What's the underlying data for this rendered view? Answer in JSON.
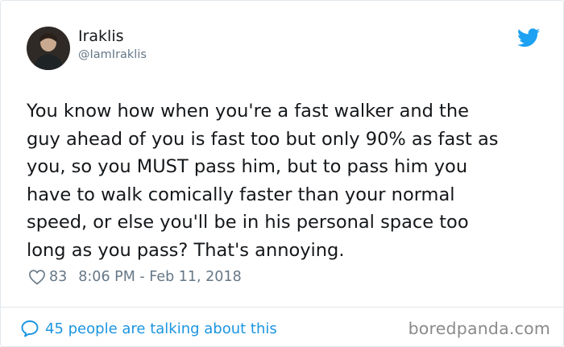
{
  "author": {
    "name": "Iraklis",
    "handle": "@IamIraklis"
  },
  "tweet": {
    "text": "You know how when you're a fast walker and the\nguy ahead of you is fast too but only 90% as fast as\nyou, so you MUST pass him, but to pass him you\nhave to walk comically faster than your normal\nspeed, or else you'll be in his personal space too\nlong as you pass? That's annoying.",
    "likes": "83",
    "timestamp": "8:06 PM - Feb 11, 2018"
  },
  "footer": {
    "conversation_label": "45 people are talking about this",
    "watermark": "boredpanda.com"
  },
  "icons": {
    "brand": "twitter-bird-icon",
    "like": "heart-icon",
    "conversation": "speech-bubble-icon"
  },
  "colors": {
    "twitter_blue": "#1da1f2",
    "link_blue": "#1b95e0",
    "muted_gray": "#657786",
    "text_dark": "#14171a",
    "border": "#e1e8ed"
  }
}
